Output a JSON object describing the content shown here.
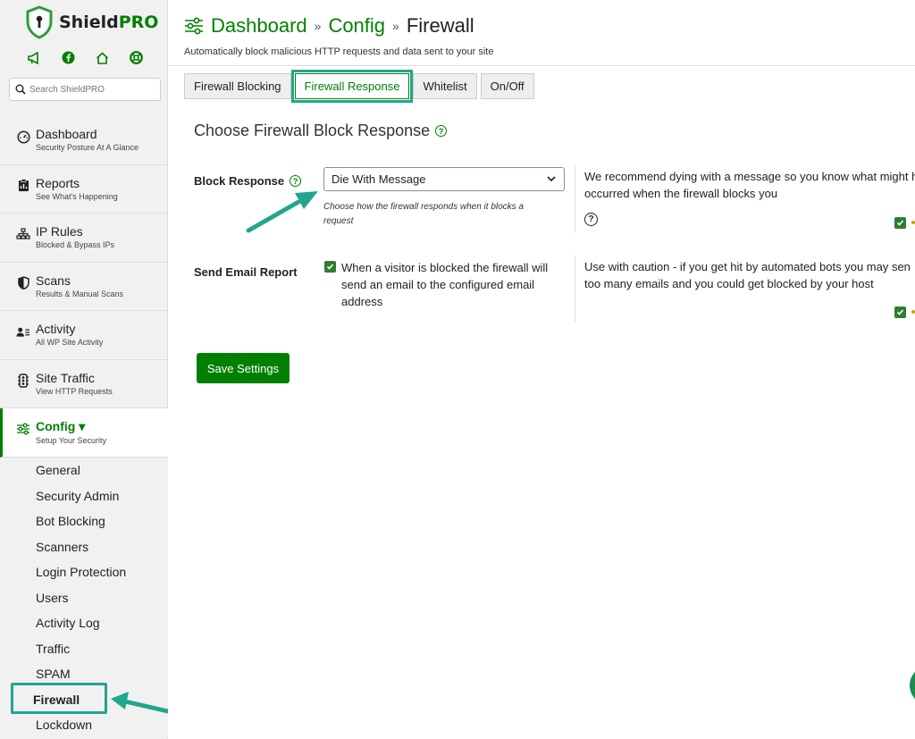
{
  "brand": {
    "name_part1": "Shield",
    "name_part2": "PRO"
  },
  "quick_icons": [
    "megaphone-icon",
    "facebook-icon",
    "home-icon",
    "support-icon"
  ],
  "search": {
    "placeholder": "Search ShieldPRO"
  },
  "nav": [
    {
      "title": "Dashboard",
      "subtitle": "Security Posture At A Glance",
      "icon": "dashboard-icon"
    },
    {
      "title": "Reports",
      "subtitle": "See What's Happening",
      "icon": "reports-icon"
    },
    {
      "title": "IP Rules",
      "subtitle": "Blocked & Bypass IPs",
      "icon": "ip-rules-icon"
    },
    {
      "title": "Scans",
      "subtitle": "Results & Manual Scans",
      "icon": "shield-icon"
    },
    {
      "title": "Activity",
      "subtitle": "All WP Site Activity",
      "icon": "activity-icon"
    },
    {
      "title": "Site Traffic",
      "subtitle": "View HTTP Requests",
      "icon": "traffic-icon"
    },
    {
      "title": "Config ▾",
      "subtitle": "Setup Your Security",
      "icon": "config-icon",
      "active": true
    }
  ],
  "config_menu": [
    "General",
    "Security Admin",
    "Bot Blocking",
    "Scanners",
    "Login Protection",
    "Users",
    "Activity Log",
    "Traffic",
    "SPAM",
    "Firewall",
    "Lockdown"
  ],
  "breadcrumb": {
    "item1": "Dashboard",
    "item2": "Config",
    "current": "Firewall",
    "separator": "»"
  },
  "page_subtitle": "Automatically block malicious HTTP requests and data sent to your site",
  "tabs": [
    {
      "label": "Firewall Blocking"
    },
    {
      "label": "Firewall Response",
      "active": true
    },
    {
      "label": "Whitelist"
    },
    {
      "label": "On/Off"
    }
  ],
  "section_title": "Choose Firewall Block Response",
  "block_response": {
    "label": "Block Response",
    "selected": "Die With Message",
    "hint": "Choose how the firewall responds when it blocks a request",
    "description_line1": "We recommend dying with a message so you know what might h",
    "description_line2": "occurred when the firewall blocks you"
  },
  "email_report": {
    "label": "Send Email Report",
    "checkbox_text": "When a visitor is blocked the firewall will send an email to the configured email address",
    "description_line1": "Use with caution - if you get hit by automated bots you may sen",
    "description_line2": "too many emails and you could get blocked by your host"
  },
  "save_label": "Save Settings",
  "colors": {
    "accent": "#008000",
    "highlight": "#22a68c"
  }
}
